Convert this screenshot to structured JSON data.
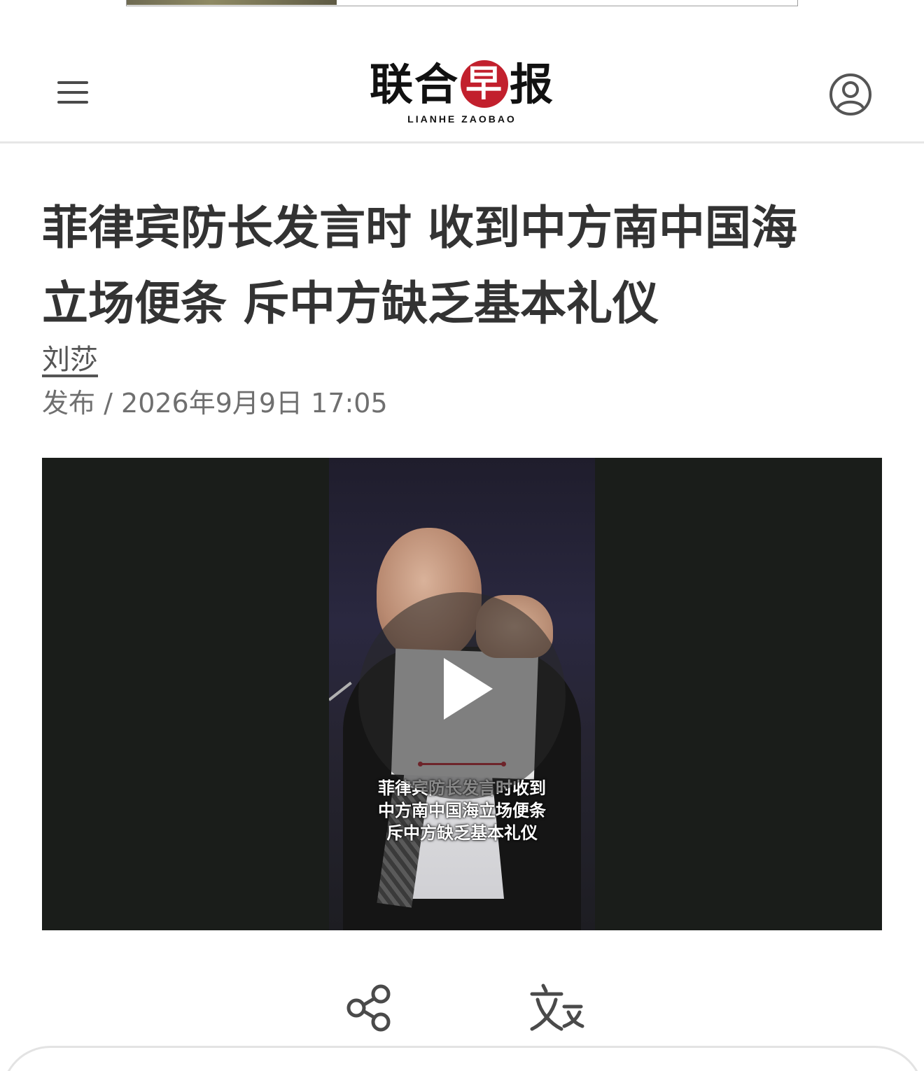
{
  "header": {
    "logo_cn": [
      "联",
      "合",
      "早",
      "报"
    ],
    "logo_en": "LIANHE ZAOBAO",
    "brand_color": "#c2202d",
    "menu_icon": "hamburger-menu-icon",
    "account_icon": "user-account-icon"
  },
  "article": {
    "title_line1": "菲律宾防长发言时 收到中方南中国海",
    "title_line2": "立场便条 斥中方缺乏基本礼仪",
    "author": "刘莎",
    "publish_label": "发布",
    "publish_separator": "/",
    "publish_datetime": "2026年9月9日 17:05"
  },
  "video": {
    "caption_line1": "菲律宾防长发言时收到",
    "caption_line2": "中方南中国海立场便条",
    "caption_line3": "斥中方缺乏基本礼仪",
    "play_icon": "play-icon"
  },
  "actions": {
    "share_icon": "share-icon",
    "translate_icon": "translate-icon"
  }
}
